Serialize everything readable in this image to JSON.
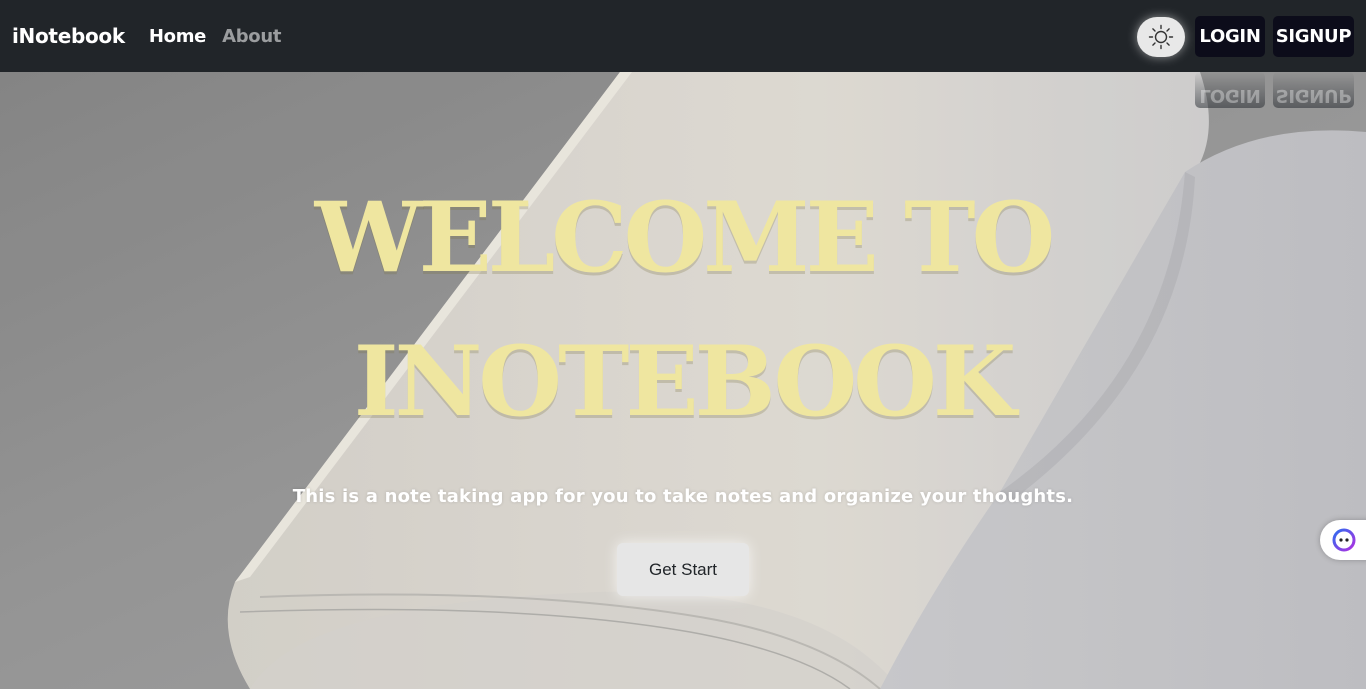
{
  "navbar": {
    "brand": "iNotebook",
    "links": [
      {
        "label": "Home"
      },
      {
        "label": "About"
      }
    ],
    "theme_toggle_icon": "sun-icon",
    "login_label": "LOGIN",
    "signup_label": "SIGNUP"
  },
  "hero": {
    "headline_line1": "WELCOME TO",
    "headline_line2": "INOTEBOOK",
    "tagline": "This is a note taking app for you to take notes and organize your thoughts.",
    "cta_label": "Get Start",
    "background_icon": "open-book-image"
  },
  "widget": {
    "icon": "assistant-face-icon"
  },
  "colors": {
    "navbar_bg": "#212529",
    "headline": "#efe6a0",
    "auth_button_bg": "#0c0c1a",
    "cta_bg": "#e6e6e6"
  }
}
